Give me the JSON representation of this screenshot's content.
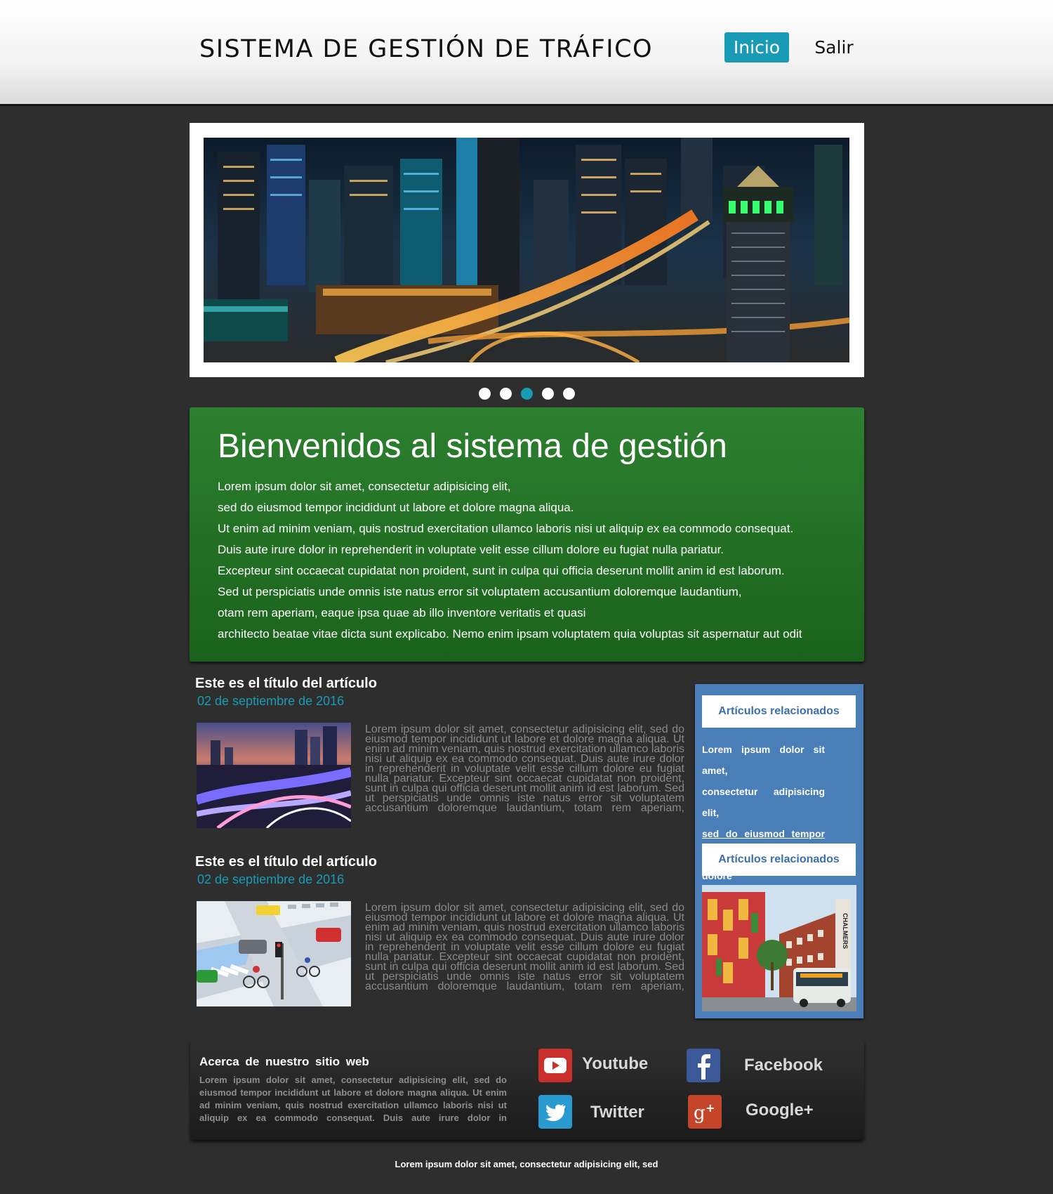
{
  "header": {
    "title": "SISTEMA DE GESTIÓN DE TRÁFICO",
    "nav": {
      "home": "Inicio",
      "logout": "Salir"
    },
    "accent_color": "#1a9bb5"
  },
  "slider": {
    "slide_count": 5,
    "active_slide": 3
  },
  "welcome": {
    "title": "Bienvenidos al sistema de gestión",
    "lines": [
      "Lorem ipsum dolor sit amet, consectetur adipisicing elit,",
      "sed do eiusmod tempor incididunt ut labore et dolore magna aliqua.",
      "Ut enim ad minim veniam, quis nostrud exercitation ullamco laboris nisi ut aliquip ex ea commodo consequat.",
      "Duis aute irure dolor in reprehenderit in voluptate velit esse cillum dolore eu fugiat nulla pariatur.",
      "Excepteur sint occaecat cupidatat non proident, sunt in culpa qui officia deserunt mollit anim id est laborum.",
      "Sed ut perspiciatis unde omnis iste natus error sit voluptatem accusantium doloremque laudantium,",
      "otam rem aperiam, eaque ipsa quae ab illo inventore veritatis et quasi",
      "architecto beatae vitae dicta sunt explicabo. Nemo enim ipsam voluptatem quia voluptas sit aspernatur aut odit"
    ],
    "background_color": "#237326"
  },
  "articles": [
    {
      "title": "Este es el título del artículo",
      "date": "02 de septiembre de 2016",
      "body": "Lorem ipsum dolor sit amet, consectetur adipisicing elit, sed do eiusmod tempor incididunt ut labore et dolore magna aliqua. Ut enim ad minim veniam, quis nostrud exercitation ullamco laboris nisi ut aliquip ex ea commodo consequat. Duis aute irure dolor in reprehenderit in voluptate velit esse cillum dolore eu fugiat nulla pariatur. Excepteur sint occaecat cupidatat non proident, sunt in culpa qui officia deserunt mollit anim id est laborum. Sed ut perspiciatis unde omnis iste natus error sit voluptatem accusantium doloremque laudantium, totam rem aperiam,"
    },
    {
      "title": "Este es el título del artículo",
      "date": "02 de septiembre de 2016",
      "body": "Lorem ipsum dolor sit amet, consectetur adipisicing elit, sed do eiusmod tempor incididunt ut labore et dolore magna aliqua. Ut enim ad minim veniam, quis nostrud exercitation ullamco laboris nisi ut aliquip ex ea commodo consequat. Duis aute irure dolor in reprehenderit in voluptate velit esse cillum dolore eu fugiat nulla pariatur. Excepteur sint occaecat cupidatat non proident, sunt in culpa qui officia deserunt mollit anim id est laborum. Sed ut perspiciatis unde omnis iste natus error sit voluptatem accusantium doloremque laudantium, totam rem aperiam,"
    }
  ],
  "sidebar": {
    "heading_1": "Artículos relacionados",
    "heading_2": "Artículos relacionados",
    "text_lines": [
      "Lorem ipsum dolor sit amet,",
      "consectetur adipisicing elit,",
      "sed do eiusmod tempor",
      "incididunt ut labore et dolore"
    ],
    "photo_sign": "CHALMERS",
    "background_color": "#4a7eb8"
  },
  "footer": {
    "about_title": "Acerca de nuestro sitio web",
    "about_text": "Lorem ipsum dolor sit amet, consectetur adipisicing elit, sed do eiusmod tempor incididunt ut labore et dolore magna aliqua. Ut enim ad minim veniam, quis nostrud exercitation ullamco laboris nisi ut aliquip ex ea commodo consequat. Duis aute irure dolor in",
    "social": {
      "youtube": "Youtube",
      "facebook": "Facebook",
      "twitter": "Twitter",
      "google": "Google+"
    },
    "icons": [
      "youtube-icon",
      "facebook-icon",
      "twitter-icon",
      "google-plus-icon"
    ],
    "bottom_text": "Lorem ipsum dolor sit amet, consectetur adipisicing elit, sed"
  }
}
